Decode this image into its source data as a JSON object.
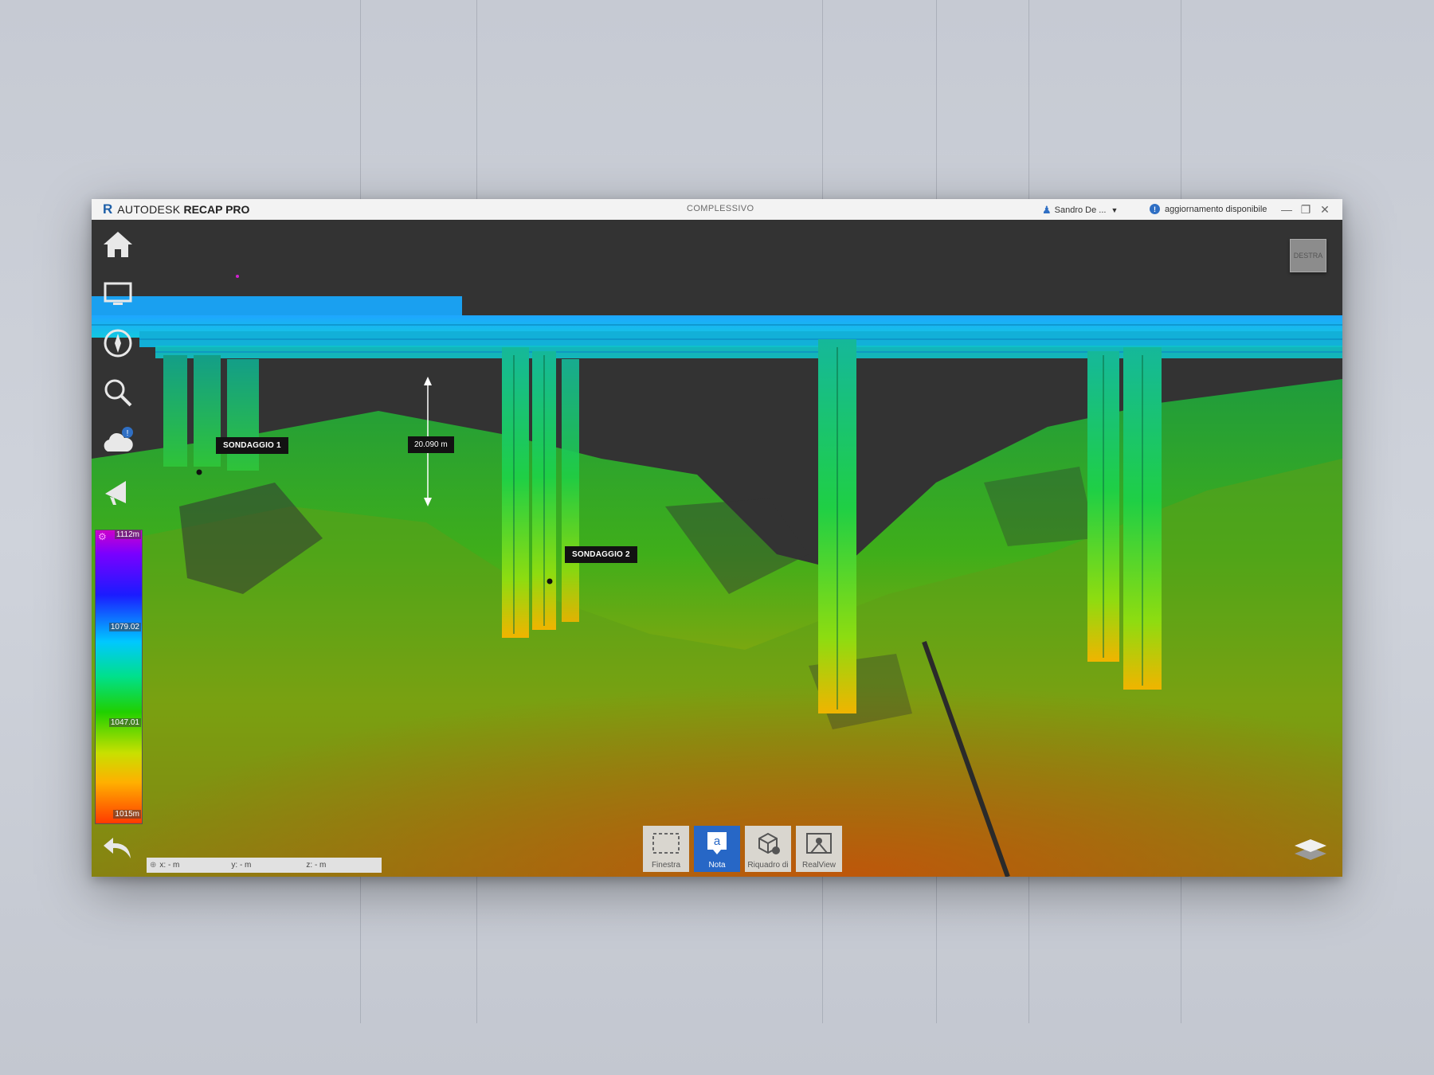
{
  "app": {
    "brand_logo": "R",
    "brand_name": "AUTODESK",
    "brand_product": "RECAP PRO",
    "document_title": "COMPLESSIVO",
    "user_name": "Sandro De ...",
    "update_notice": "aggiornamento disponibile"
  },
  "window_controls": {
    "minimize": "—",
    "restore": "❐",
    "close": "✕"
  },
  "sidebar": {
    "items": [
      {
        "name": "home",
        "icon": "home-icon"
      },
      {
        "name": "display",
        "icon": "monitor-icon"
      },
      {
        "name": "navigation",
        "icon": "compass-icon"
      },
      {
        "name": "search",
        "icon": "search-icon"
      },
      {
        "name": "cloud",
        "icon": "cloud-icon",
        "badge": "!"
      },
      {
        "name": "share",
        "icon": "megaphone-icon"
      }
    ]
  },
  "color_legend": {
    "max": "1112m",
    "mid_high": "1079.02",
    "mid_low": "1047.01",
    "min": "1015m"
  },
  "annotations": {
    "tag1": "SONDAGGIO 1",
    "tag2": "SONDAGGIO 2",
    "measurement": "20.090 m"
  },
  "coordinates": {
    "x": "x: - m",
    "y": "y: - m",
    "z": "z: - m"
  },
  "view_cube": {
    "label": "DESTRA"
  },
  "bottom_toolbar": {
    "buttons": [
      {
        "label": "Finestra",
        "active": false
      },
      {
        "label": "Nota",
        "active": true
      },
      {
        "label": "Riquadro di",
        "active": false
      },
      {
        "label": "RealView",
        "active": false
      }
    ]
  },
  "colors": {
    "accent": "#2767c6",
    "viewport_bg": "#333333",
    "titlebar_bg": "#f3f3f3"
  }
}
